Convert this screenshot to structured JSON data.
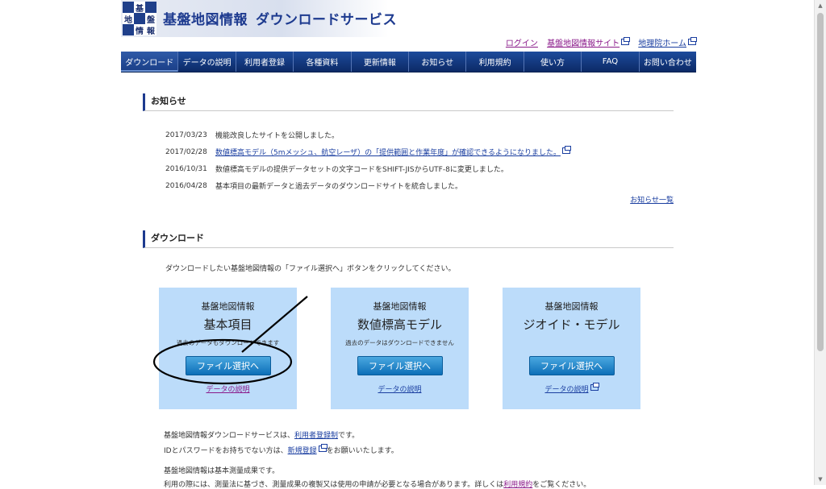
{
  "header": {
    "logo_chars": [
      "基",
      "盤",
      "地",
      "図",
      "情",
      "報"
    ],
    "title_main": "基盤地図情報",
    "title_sub": "ダウンロードサービス"
  },
  "toplinks": {
    "login": "ログイン",
    "kiban_site": "基盤地図情報サイト",
    "gsi_home": "地理院ホーム"
  },
  "nav": {
    "items": [
      "ダウンロード",
      "データの説明",
      "利用者登録",
      "各種資料",
      "更新情報",
      "お知らせ",
      "利用規約",
      "使い方",
      "FAQ",
      "お問い合わせ"
    ]
  },
  "news": {
    "heading": "お知らせ",
    "items": [
      {
        "date": "2017/03/23",
        "text": "機能改良したサイトを公開しました。"
      },
      {
        "date": "2017/02/28",
        "text": "数値標高モデル（5mメッシュ、航空レーザ）の「提供範囲と作業年度」が確認できるようになりました。"
      },
      {
        "date": "2016/10/31",
        "text": "数値標高モデルの提供データセットの文字コードをSHIFT-JISからUTF-8に変更しました。"
      },
      {
        "date": "2016/04/28",
        "text": "基本項目の最新データと過去データのダウンロードサイトを統合しました。"
      }
    ],
    "more": "お知らせ一覧"
  },
  "download": {
    "heading": "ダウンロード",
    "intro": "ダウンロードしたい基盤地図情報の「ファイル選択へ」ボタンをクリックしてください。",
    "cards": [
      {
        "kiban": "基盤地図情報",
        "name": "基本項目",
        "note": "過去のデータもダウンロードできます",
        "button": "ファイル選択へ",
        "desc": "データの説明"
      },
      {
        "kiban": "基盤地図情報",
        "name": "数値標高モデル",
        "note": "過去のデータはダウンロードできません",
        "button": "ファイル選択へ",
        "desc": "データの説明"
      },
      {
        "kiban": "基盤地図情報",
        "name": "ジオイド・モデル",
        "note": "",
        "button": "ファイル選択へ",
        "desc": "データの説明"
      }
    ]
  },
  "footer": {
    "line1_pre": "基盤地図情報ダウンロードサービスは、",
    "line1_link": "利用者登録制",
    "line1_post": "です。",
    "line2_pre": "IDとパスワードをお持ちでない方は、",
    "line2_link": "新規登録",
    "line2_post": "をお願いいたします。",
    "line3": "基盤地図情報は基本測量成果です。",
    "line4_pre": "利用の際には、測量法に基づき、測量成果の複製又は使用の申請が必要となる場合があります。詳しくは",
    "line4_link": "利用規約",
    "line4_post": "をご覧ください。"
  },
  "colors": {
    "nav_bg": "#0c2a66",
    "card_bg": "#bcdcfa",
    "button": "#0d6fb8",
    "link": "#1a3ea0",
    "visited_link": "#8a1a8a"
  }
}
